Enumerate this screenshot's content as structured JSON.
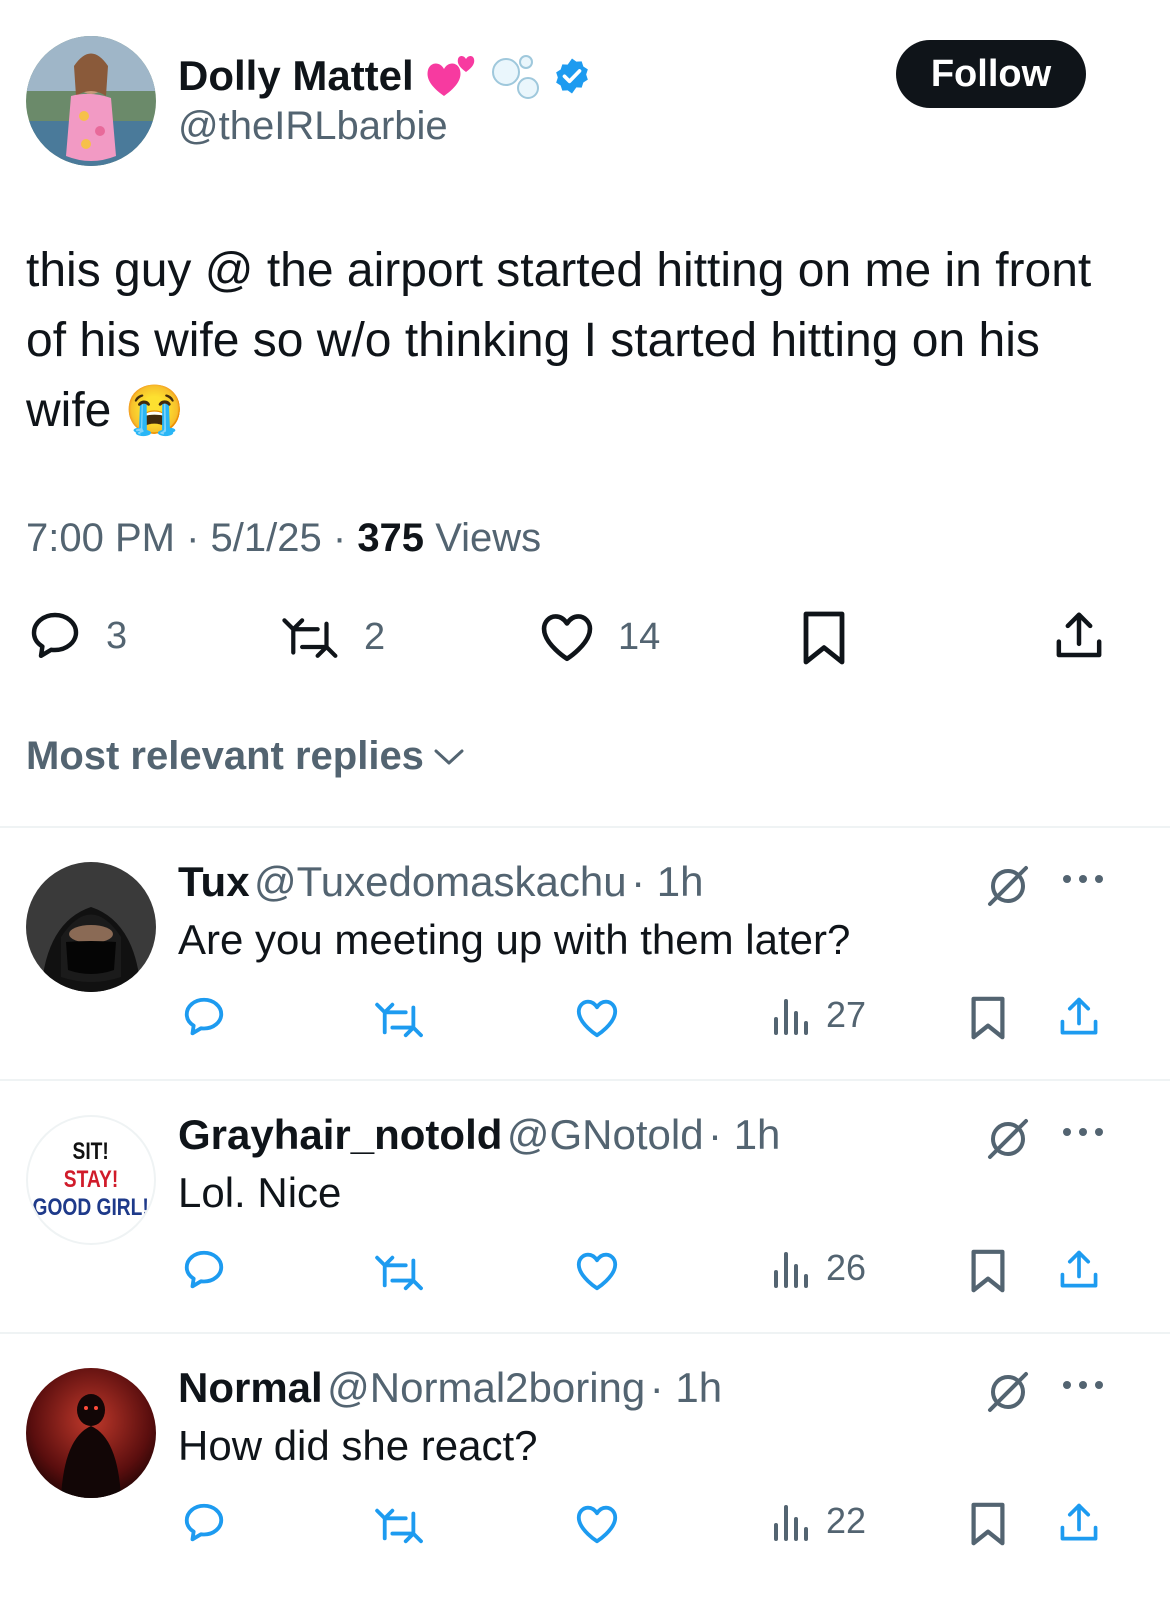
{
  "post": {
    "display_name": "Dolly Mattel",
    "handle": "@theIRLbarbie",
    "follow_label": "Follow",
    "text": "this guy @ the airport started hitting on me in front of his wife so w/o thinking I started hitting on his wife",
    "emoji": "😭",
    "time": "7:00 PM",
    "date": "5/1/25",
    "views_count": "375",
    "views_label": "Views",
    "replies": "3",
    "reposts": "2",
    "likes": "14"
  },
  "replies_header": {
    "label": "Most relevant replies"
  },
  "replies": [
    {
      "name": "Tux",
      "handle": "@Tuxedomaskachu",
      "time": "1h",
      "text": "Are you meeting up with them later?",
      "views": "27"
    },
    {
      "name": "Grayhair_notold",
      "handle": "@GNotold",
      "time": "1h",
      "text": "Lol. Nice",
      "views": "26",
      "avatar_text": [
        "SIT!",
        "STAY!",
        "GOOD GIRL!"
      ]
    },
    {
      "name": "Normal",
      "handle": "@Normal2boring",
      "time": "1h",
      "text": "How did she react?",
      "views": "22"
    }
  ],
  "colors": {
    "accent_blue": "#1d9bf0",
    "text_secondary": "#536471",
    "follow_bg": "#0f1419"
  },
  "icons": [
    "verified-badge-icon",
    "hearts-icon",
    "bubbles-icon",
    "reply-icon",
    "repost-icon",
    "like-icon",
    "bookmark-icon",
    "share-icon",
    "views-icon",
    "grok-icon",
    "more-icon",
    "chevron-down-icon"
  ]
}
